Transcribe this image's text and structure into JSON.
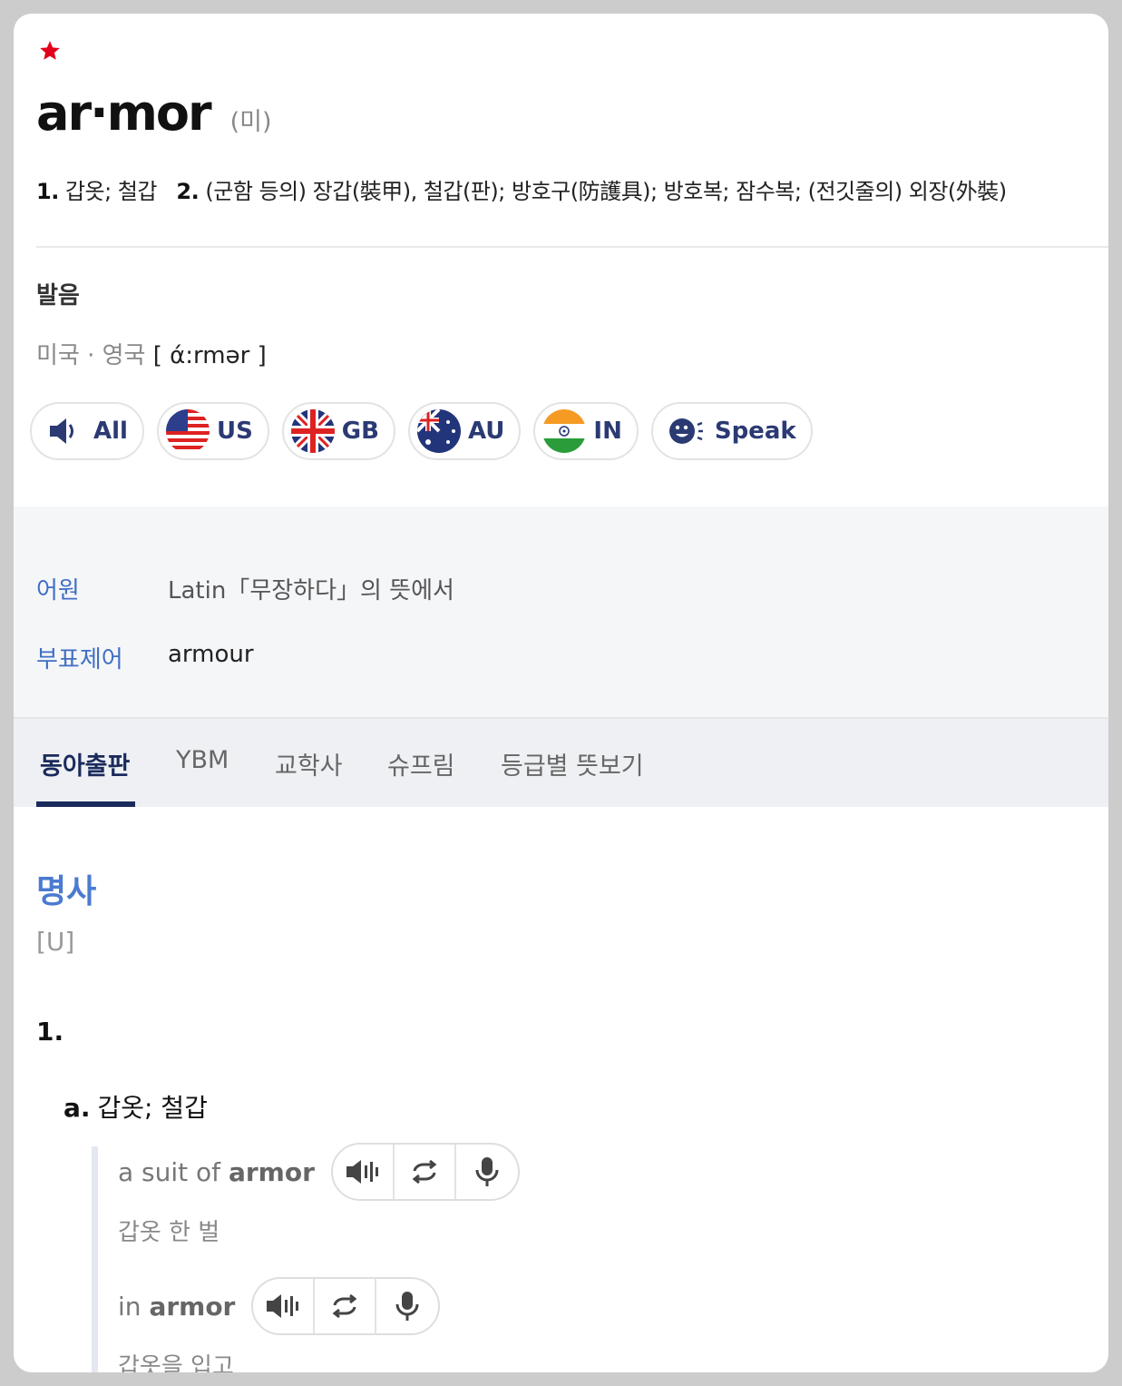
{
  "entry": {
    "headword": "ar·mor",
    "origin": "(미)",
    "meanings_line": [
      {
        "num": "1.",
        "text": "갑옷; 철갑"
      },
      {
        "num": "2.",
        "text": "(군함 등의) 장갑(裝甲), 철갑(판); 방호구(防護具); 방호복; 잠수복; (전깃줄의) 외장(外裝)"
      }
    ]
  },
  "pronunciation": {
    "label": "발음",
    "region": "미국 · 영국",
    "ipa": "[ ά:rmər ]",
    "buttons": [
      {
        "label": "All",
        "icon": "speaker-icon"
      },
      {
        "label": "US",
        "icon": "us-flag-icon"
      },
      {
        "label": "GB",
        "icon": "gb-flag-icon"
      },
      {
        "label": "AU",
        "icon": "au-flag-icon"
      },
      {
        "label": "IN",
        "icon": "in-flag-icon"
      },
      {
        "label": "Speak",
        "icon": "speak-face-icon"
      }
    ]
  },
  "etymology": {
    "label": "어원",
    "value": "Latin「무장하다」의 뜻에서",
    "variant_label": "부표제어",
    "variant_value": "armour"
  },
  "tabs": [
    "동아출판",
    "YBM",
    "교학사",
    "슈프림",
    "등급별 뜻보기"
  ],
  "active_tab": "동아출판",
  "definition": {
    "pos": "명사",
    "grammar": "[U]",
    "sense_number": "1.",
    "sub_label": "a.",
    "sub_text": "갑옷; 철갑",
    "examples": [
      {
        "pre": "a suit of ",
        "bold": "armor",
        "ko": "갑옷 한 벌"
      },
      {
        "pre": "in ",
        "bold": "armor",
        "ko": "갑옷을 입고"
      }
    ]
  },
  "colors": {
    "accent": "#3f6fc4",
    "tab_active": "#1a2a5c",
    "star": "#e2001a"
  }
}
